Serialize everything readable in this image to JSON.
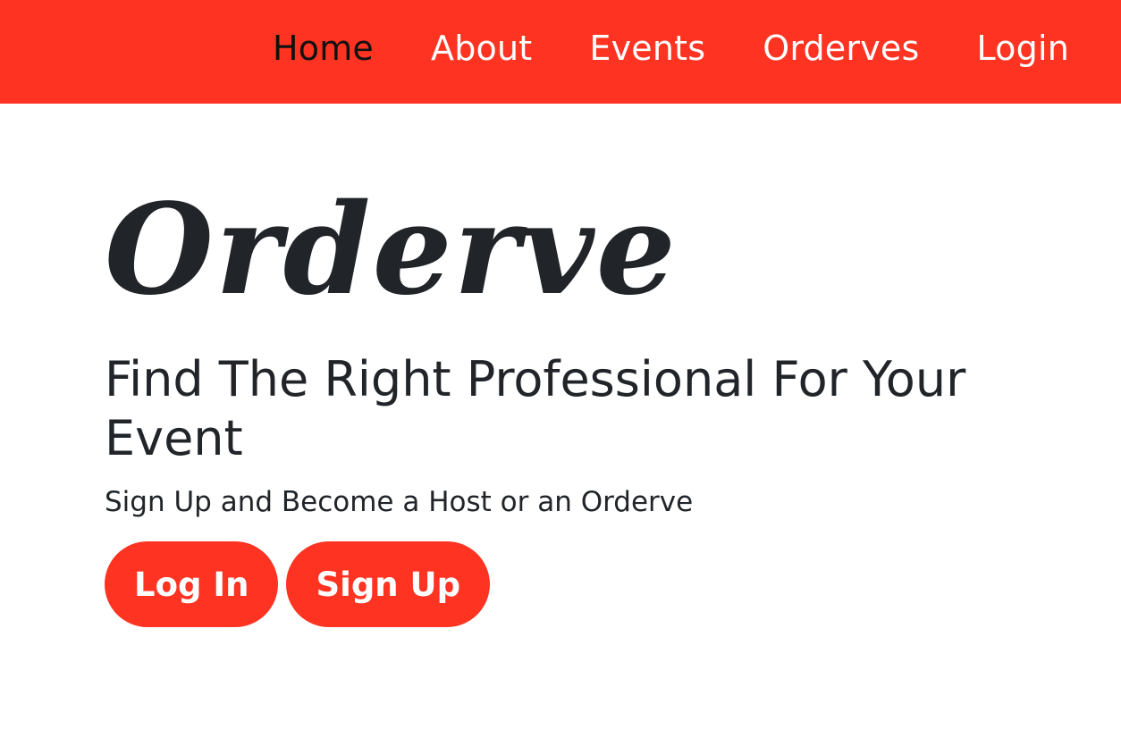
{
  "colors": {
    "accent": "#ff3322",
    "text": "#212529",
    "nav_text": "#ffffff",
    "nav_active_text": "#111111"
  },
  "nav": {
    "items": [
      {
        "label": "Home",
        "active": true
      },
      {
        "label": "About",
        "active": false
      },
      {
        "label": "Events",
        "active": false
      },
      {
        "label": "Orderves",
        "active": false
      },
      {
        "label": "Login",
        "active": false
      }
    ]
  },
  "hero": {
    "title": "Orderve",
    "tagline": "Find The Right Professional For Your Event",
    "subtext": "Sign Up and Become a Host or an Orderve",
    "login_button": "Log In",
    "signup_button": "Sign Up"
  }
}
